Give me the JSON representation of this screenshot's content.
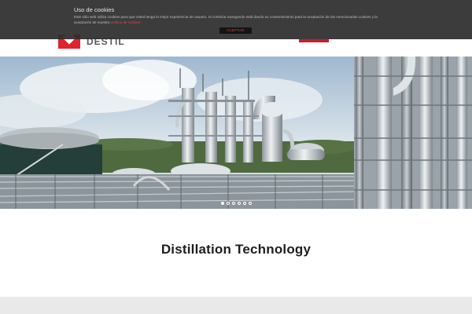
{
  "brand": {
    "name": "DESTIL",
    "accent_color": "#e0232e"
  },
  "cookie_notice": {
    "title": "Uso de cookies",
    "text": "Este sitio web utiliza cookies para que usted tenga la mejor experiencia de usuario. Si continúa navegando está dando su consentimiento para la aceptación de las mencionadas cookies y la aceptación de nuestra ",
    "policy_link": "política de cookies",
    "accept_label": "ACEPTAR"
  },
  "hero": {
    "slide_count": 6,
    "active_slide": 1,
    "image_subject": "industrial distillation plant"
  },
  "main": {
    "heading": "Distillation Technology"
  }
}
